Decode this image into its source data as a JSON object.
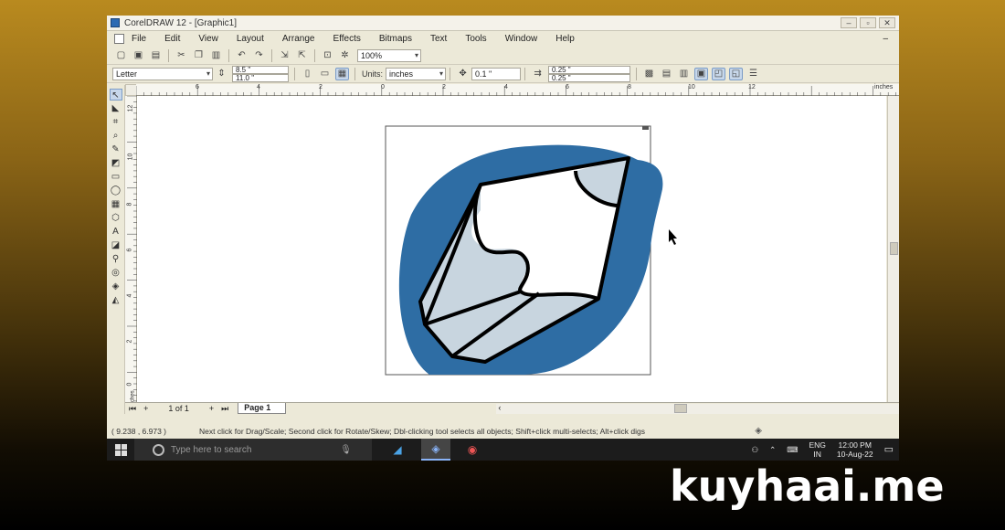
{
  "window": {
    "title": "CorelDRAW 12 - [Graphic1]",
    "controls": [
      "–",
      "▫",
      "✕"
    ],
    "doc_controls": [
      "–"
    ]
  },
  "menu": {
    "items": [
      "File",
      "Edit",
      "View",
      "Layout",
      "Arrange",
      "Effects",
      "Bitmaps",
      "Text",
      "Tools",
      "Window",
      "Help"
    ]
  },
  "standard_toolbar": {
    "zoom": "100%"
  },
  "property_bar": {
    "paper": "Letter",
    "width": "8.5 \"",
    "height": "11.0 \"",
    "units_label": "Units:",
    "units": "inches",
    "nudge": "0.1 \"",
    "dup_x": "0.25 \"",
    "dup_y": "0.25 \""
  },
  "rulers": {
    "horizontal_ticks": [
      "6",
      "4",
      "2",
      "0",
      "2",
      "4",
      "6",
      "8",
      "10",
      "12",
      "inches"
    ],
    "vertical_ticks": [
      "12",
      "10",
      "8",
      "6",
      "4",
      "2",
      "0"
    ],
    "vertical_unit": "inches"
  },
  "page_nav": {
    "count": "1 of 1",
    "tab": "Page 1"
  },
  "status": {
    "coords": "( 9.238 , 6.973 )",
    "hint": "Next click for Drag/Scale; Second click for Rotate/Skew; Dbl-clicking tool selects all objects; Shift+click multi-selects; Alt+click digs"
  },
  "taskbar": {
    "search_placeholder": "Type here to search",
    "lang_top": "ENG",
    "lang_bottom": "IN",
    "time": "12:00 PM",
    "date": "10-Aug-22"
  },
  "drawing": {
    "circle_color": "#2e6da4",
    "fill_color": "#c8d5df",
    "outline_color": "#000000"
  },
  "watermark": "kuyhaai.me"
}
